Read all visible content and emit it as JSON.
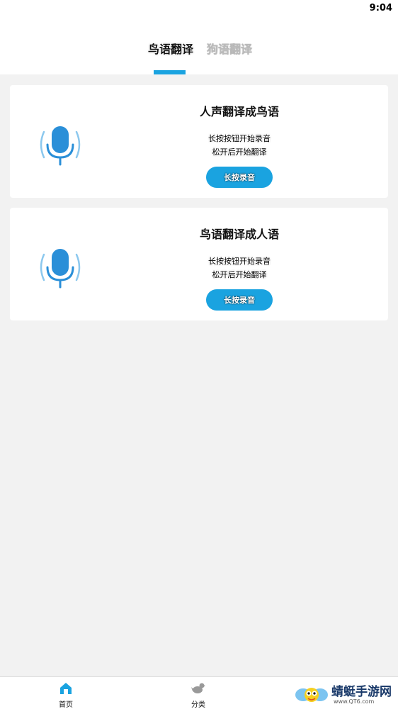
{
  "status_bar": {
    "time": "9:04"
  },
  "tabs": [
    {
      "label": "鸟语翻译",
      "active": true
    },
    {
      "label": "狗语翻译",
      "active": false
    }
  ],
  "accent_color": "#1aa3e0",
  "cards": [
    {
      "title": "人声翻译成鸟语",
      "line1": "长按按钮开始录音",
      "line2": "松开后开始翻译",
      "button": "长按录音",
      "icon": "microphone-icon"
    },
    {
      "title": "鸟语翻译成人语",
      "line1": "长按按钮开始录音",
      "line2": "松开后开始翻译",
      "button": "长按录音",
      "icon": "microphone-icon"
    }
  ],
  "bottom_nav": [
    {
      "label": "首页",
      "icon": "home-icon",
      "active": true
    },
    {
      "label": "分类",
      "icon": "bird-icon",
      "active": false
    }
  ],
  "watermark": {
    "name": "蜻蜓手游网",
    "url": "www.QT6.com"
  }
}
